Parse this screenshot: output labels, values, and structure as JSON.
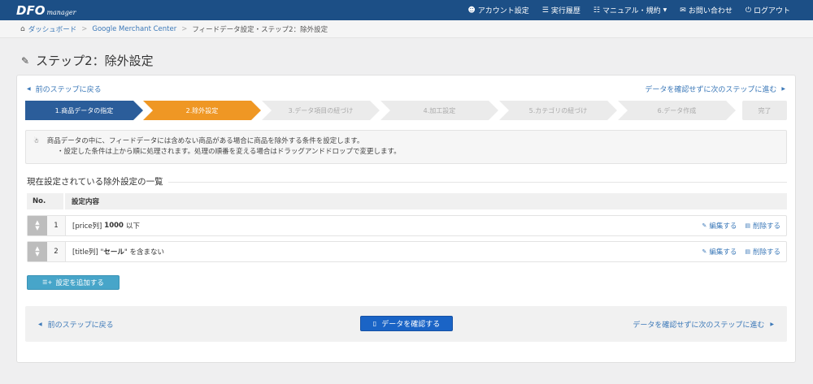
{
  "app": {
    "logo_main": "DFO",
    "logo_sub": "manager"
  },
  "nav": {
    "items": [
      {
        "icon": "user-icon",
        "label": "アカウント設定"
      },
      {
        "icon": "list-icon",
        "label": "実行履歴"
      },
      {
        "icon": "book-icon",
        "label": "マニュアル・規約"
      },
      {
        "icon": "envelope-icon",
        "label": "お問い合わせ"
      },
      {
        "icon": "power-icon",
        "label": "ログアウト"
      }
    ]
  },
  "breadcrumb": {
    "items": [
      "ダッシュボード",
      "Google Merchant Center",
      "フィードデータ設定・ステップ2：除外設定"
    ]
  },
  "page": {
    "title": "ステップ2：除外設定"
  },
  "links": {
    "prev_step": "前のステップに戻る",
    "skip_next": "データを確認せずに次のステップに進む"
  },
  "steps": [
    {
      "label": "1.商品データの指定",
      "state": "done"
    },
    {
      "label": "2.除外設定",
      "state": "active"
    },
    {
      "label": "3.データ項目の紐づけ",
      "state": "todo"
    },
    {
      "label": "4.加工設定",
      "state": "todo"
    },
    {
      "label": "5.カテゴリの紐づけ",
      "state": "todo"
    },
    {
      "label": "6.データ作成",
      "state": "todo"
    },
    {
      "label": "完了",
      "state": "todo"
    }
  ],
  "info": {
    "line1": "商品データの中に、フィードデータには含めない商品がある場合に商品を除外する条件を設定します。",
    "line2": "・設定した条件は上から順に処理されます。処理の順番を変える場合はドラッグアンドドロップで変更します。"
  },
  "section": {
    "title": "現在設定されている除外設定の一覧"
  },
  "table": {
    "headers": [
      "No.",
      "設定内容"
    ],
    "rows": [
      {
        "no": "1",
        "prefix": "[price列]",
        "value": "1000",
        "suffix": "以下"
      },
      {
        "no": "2",
        "prefix": "[title列] \"",
        "value": "セール",
        "suffix": "\" を含まない"
      }
    ],
    "edit_label": "編集する",
    "delete_label": "削除する"
  },
  "buttons": {
    "add": "設定を追加する",
    "confirm": "データを確認する"
  },
  "colors": {
    "navbar": "#1c4f86",
    "step_done": "#2b5d9a",
    "step_active": "#ef9724",
    "step_todo": "#ebebeb",
    "add_button": "#47a5c9",
    "confirm_button": "#1a64c6",
    "link": "#3b78b8"
  }
}
